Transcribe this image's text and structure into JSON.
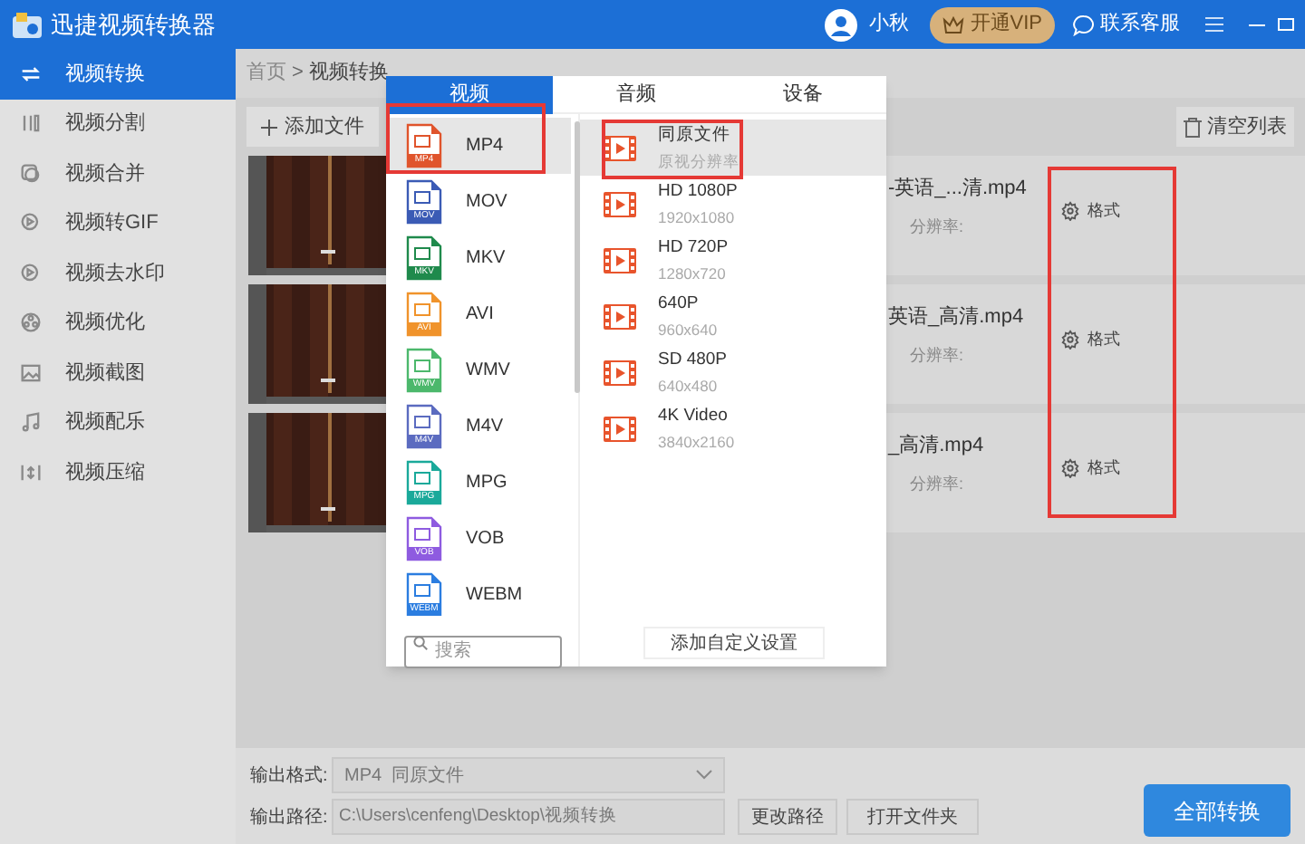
{
  "window": {
    "title": "迅捷视频转换器"
  },
  "header": {
    "user": "小秋",
    "vip_button": "开通VIP",
    "support": "联系客服"
  },
  "sidebar": {
    "items": [
      {
        "label": "视频转换",
        "selected": true
      },
      {
        "label": "视频分割",
        "selected": false
      },
      {
        "label": "视频合并",
        "selected": false
      },
      {
        "label": "视频转GIF",
        "selected": false
      },
      {
        "label": "视频去水印",
        "selected": false
      },
      {
        "label": "视频优化",
        "selected": false
      },
      {
        "label": "视频截图",
        "selected": false
      },
      {
        "label": "视频配乐",
        "selected": false
      },
      {
        "label": "视频压缩",
        "selected": false
      }
    ]
  },
  "breadcrumb": {
    "items": [
      "首页",
      "视频转换"
    ],
    "separator": ">"
  },
  "toolbar": {
    "add_button": "添加文件",
    "clear_button": "清空列表"
  },
  "files": [
    {
      "name": "-英语_...清.mp4",
      "resolution_label": "分辨率:",
      "format_button": "格式"
    },
    {
      "name": "英语_高清.mp4",
      "resolution_label": "分辨率:",
      "format_button": "格式"
    },
    {
      "name": "_高清.mp4",
      "resolution_label": "分辨率:",
      "format_button": "格式"
    }
  ],
  "format_popup": {
    "tabs": [
      {
        "label": "视频",
        "selected": true
      },
      {
        "label": "音频",
        "selected": false
      },
      {
        "label": "设备",
        "selected": false
      }
    ],
    "formats": [
      {
        "name": "MP4",
        "icon_label": "MP4",
        "color": "#e0542c",
        "selected": true
      },
      {
        "name": "MOV",
        "icon_label": "MOV",
        "color": "#3b5bb5",
        "selected": false
      },
      {
        "name": "MKV",
        "icon_label": "MKV",
        "color": "#1f8a4c",
        "selected": false
      },
      {
        "name": "AVI",
        "icon_label": "AVI",
        "color": "#f0932b",
        "selected": false
      },
      {
        "name": "WMV",
        "icon_label": "WMV",
        "color": "#4cb86c",
        "selected": false
      },
      {
        "name": "M4V",
        "icon_label": "M4V",
        "color": "#5b6bc0",
        "selected": false
      },
      {
        "name": "MPG",
        "icon_label": "MPG",
        "color": "#1aa99a",
        "selected": false
      },
      {
        "name": "VOB",
        "icon_label": "VOB",
        "color": "#8e5be0",
        "selected": false
      },
      {
        "name": "WEBM",
        "icon_label": "WEBM",
        "color": "#2b7de0",
        "selected": false
      }
    ],
    "search": {
      "placeholder": "搜索"
    },
    "presets": [
      {
        "name": "同原文件",
        "detail": "原视分辨率",
        "selected": true
      },
      {
        "name": "HD 1080P",
        "detail": "1920x1080",
        "selected": false
      },
      {
        "name": "HD 720P",
        "detail": "1280x720",
        "selected": false
      },
      {
        "name": "640P",
        "detail": "960x640",
        "selected": false
      },
      {
        "name": "SD 480P",
        "detail": "640x480",
        "selected": false
      },
      {
        "name": "4K Video",
        "detail": "3840x2160",
        "selected": false
      }
    ],
    "custom_button": "添加自定义设置"
  },
  "output": {
    "format_label": "输出格式:",
    "format_value": "MP4  同原文件",
    "path_label": "输出路径:",
    "path_value": "C:\\Users\\cenfeng\\Desktop\\视频转换",
    "change_path_button": "更改路径",
    "open_folder_button": "打开文件夹"
  },
  "convert_all_button": "全部转换"
}
